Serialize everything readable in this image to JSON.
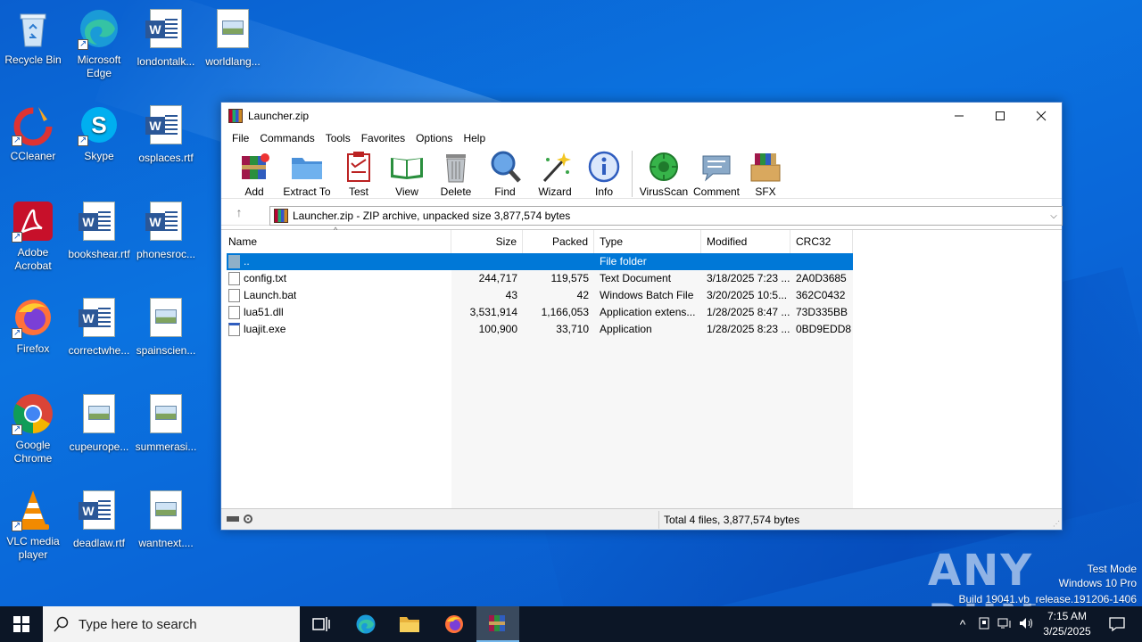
{
  "desktop": {
    "icons": [
      {
        "label": "Recycle Bin"
      },
      {
        "label": "Microsoft Edge"
      },
      {
        "label": "londontalk..."
      },
      {
        "label": "worldlang..."
      },
      {
        "label": "CCleaner"
      },
      {
        "label": "Skype"
      },
      {
        "label": "osplaces.rtf"
      },
      {
        "label": "Adobe Acrobat"
      },
      {
        "label": "bookshear.rtf"
      },
      {
        "label": "phonesroc..."
      },
      {
        "label": "Firefox"
      },
      {
        "label": "correctwhe..."
      },
      {
        "label": "spainscien..."
      },
      {
        "label": "Google Chrome"
      },
      {
        "label": "cupeurope..."
      },
      {
        "label": "summerasi..."
      },
      {
        "label": "VLC media player"
      },
      {
        "label": "deadlaw.rtf"
      },
      {
        "label": "wantnext...."
      }
    ]
  },
  "window": {
    "title": "Launcher.zip",
    "menu": [
      "File",
      "Commands",
      "Tools",
      "Favorites",
      "Options",
      "Help"
    ],
    "toolbar": [
      "Add",
      "Extract To",
      "Test",
      "View",
      "Delete",
      "Find",
      "Wizard",
      "Info",
      "VirusScan",
      "Comment",
      "SFX"
    ],
    "address": "Launcher.zip - ZIP archive, unpacked size 3,877,574 bytes",
    "columns": [
      "Name",
      "Size",
      "Packed",
      "Type",
      "Modified",
      "CRC32"
    ],
    "rows": [
      {
        "name": "..",
        "size": "",
        "packed": "",
        "type": "File folder",
        "modified": "",
        "crc": ""
      },
      {
        "name": "config.txt",
        "size": "244,717",
        "packed": "119,575",
        "type": "Text Document",
        "modified": "3/18/2025 7:23 ...",
        "crc": "2A0D3685"
      },
      {
        "name": "Launch.bat",
        "size": "43",
        "packed": "42",
        "type": "Windows Batch File",
        "modified": "3/20/2025 10:5...",
        "crc": "362C0432"
      },
      {
        "name": "lua51.dll",
        "size": "3,531,914",
        "packed": "1,166,053",
        "type": "Application extens...",
        "modified": "1/28/2025 8:47 ...",
        "crc": "73D335BB"
      },
      {
        "name": "luajit.exe",
        "size": "100,900",
        "packed": "33,710",
        "type": "Application",
        "modified": "1/28/2025 8:23 ...",
        "crc": "0BD9EDD8"
      }
    ],
    "status": "Total 4 files, 3,877,574 bytes"
  },
  "watermark": {
    "logo": "ANY RUN",
    "mode": "Test Mode",
    "os": "Windows 10 Pro",
    "build": "Build 19041.vb_release.191206-1406"
  },
  "taskbar": {
    "search_placeholder": "Type here to search",
    "time": "7:15 AM",
    "date": "3/25/2025"
  }
}
